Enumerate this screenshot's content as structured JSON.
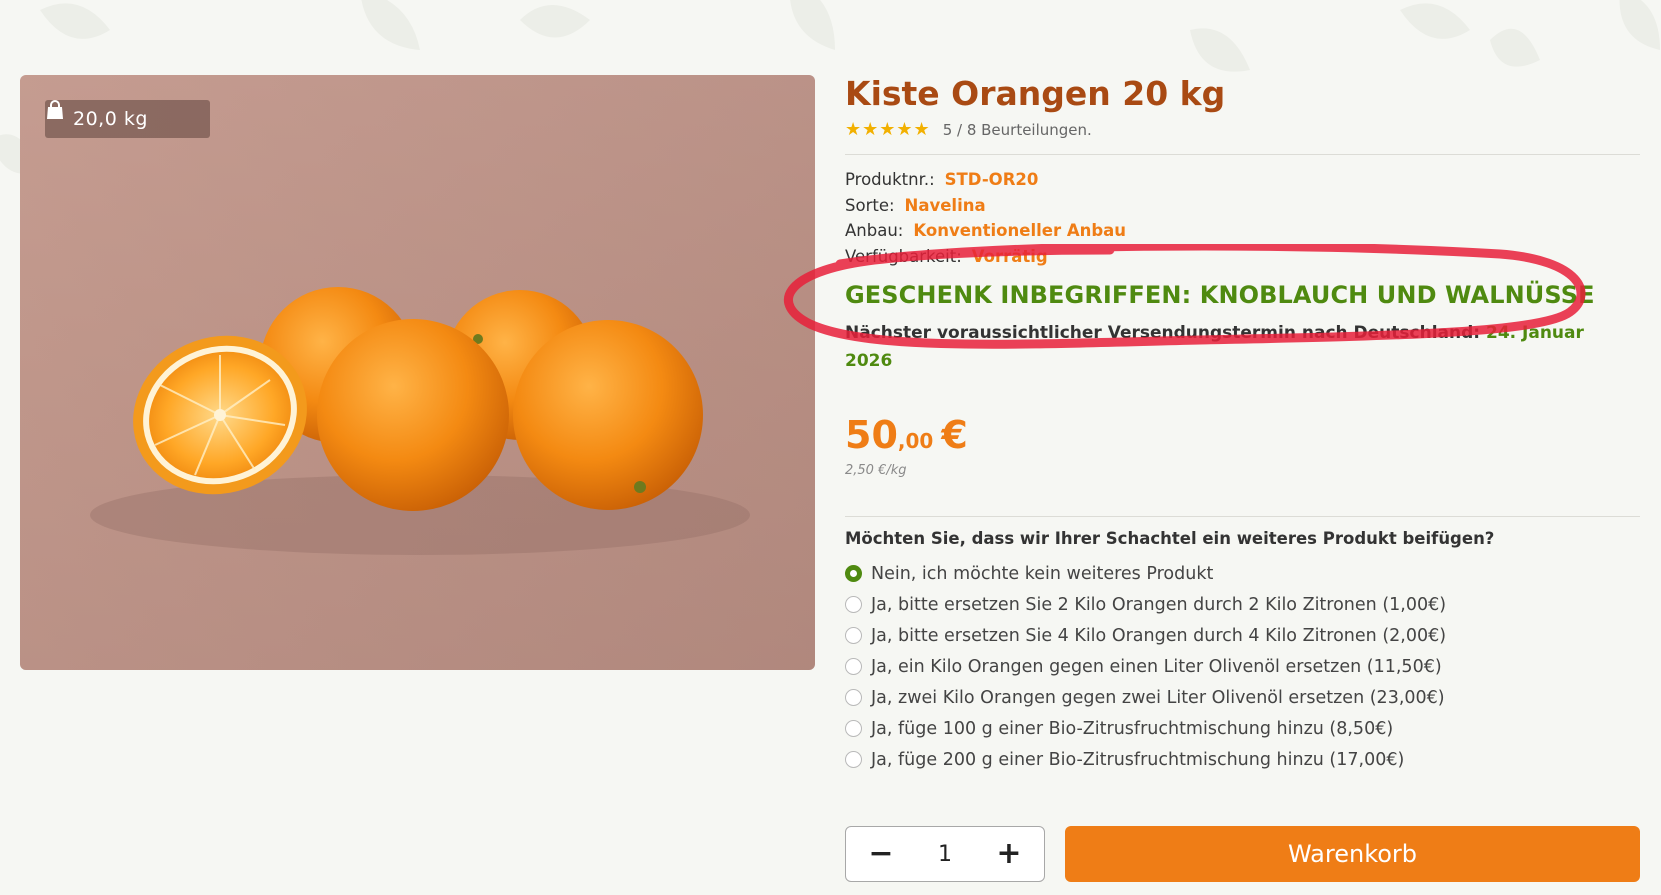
{
  "product": {
    "title": "Kiste Orangen 20 kg",
    "weight_badge": "20,0 kg",
    "stars": "★★★★★",
    "rating_text": "5 / 8 Beurteilungen."
  },
  "specs": [
    {
      "label": "Produktnr.:",
      "value": "STD-OR20"
    },
    {
      "label": "Sorte:",
      "value": "Navelina"
    },
    {
      "label": "Anbau:",
      "value": "Konventioneller Anbau"
    },
    {
      "label": "Verfügbarkeit:",
      "value": "Vorrätig"
    }
  ],
  "gift_banner": "GESCHENK INBEGRIFFEN: KNOBLAUCH UND WALNÜSSE",
  "shipping": {
    "label": "Nächster voraussichtlicher Versendungstermin nach Deutschland:",
    "date": "24. Januar 2026"
  },
  "price": {
    "integer": "50",
    "decimals": ",00",
    "currency": "€",
    "unit_price": "2,50 €/kg"
  },
  "addon": {
    "question": "Möchten Sie, dass wir Ihrer Schachtel ein weiteres Produkt beifügen?",
    "options": [
      {
        "label": "Nein, ich möchte kein weiteres Produkt",
        "selected": true
      },
      {
        "label": "Ja, bitte ersetzen Sie 2 Kilo Orangen durch 2 Kilo Zitronen (1,00€)",
        "selected": false
      },
      {
        "label": "Ja, bitte ersetzen Sie 4 Kilo Orangen durch 4 Kilo Zitronen (2,00€)",
        "selected": false
      },
      {
        "label": "Ja, ein Kilo Orangen gegen einen Liter Olivenöl ersetzen (11,50€)",
        "selected": false
      },
      {
        "label": "Ja, zwei Kilo Orangen gegen zwei Liter Olivenöl ersetzen (23,00€)",
        "selected": false
      },
      {
        "label": "Ja, füge 100 g einer Bio-Zitrusfruchtmischung hinzu (8,50€)",
        "selected": false
      },
      {
        "label": "Ja, füge 200 g einer Bio-Zitrusfruchtmischung hinzu (17,00€)",
        "selected": false
      }
    ]
  },
  "cart": {
    "minus": "−",
    "quantity": "1",
    "plus": "+",
    "button_label": "Warenkorb"
  },
  "colors": {
    "title": "#a94a13",
    "accent_orange": "#ef7d16",
    "green": "#4f8a10",
    "star": "#f2b000",
    "marker_red": "#e8203a"
  }
}
